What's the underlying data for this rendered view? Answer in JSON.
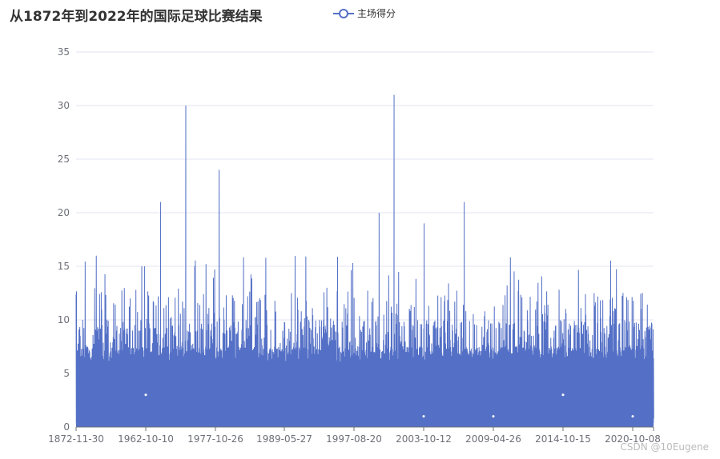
{
  "chart_data": {
    "type": "line",
    "title": "从1872年到2022年的国际足球比赛结果",
    "legend": [
      "主场得分"
    ],
    "series": [
      {
        "name": "主场得分",
        "color": "#5470c6"
      }
    ],
    "xlabel": "",
    "ylabel": "",
    "ylim": [
      0,
      35
    ],
    "yticks": [
      "0",
      "5",
      "10",
      "15",
      "20",
      "25",
      "30",
      "35"
    ],
    "xtick_labels": [
      "1872-11-30",
      "1962-10-10",
      "1977-10-26",
      "1989-05-27",
      "1997-08-20",
      "2003-10-12",
      "2009-04-26",
      "2014-10-15",
      "2020-10-08"
    ],
    "peaks": [
      {
        "x": "1966-01",
        "y": 21
      },
      {
        "x": "1971-06",
        "y": 30
      },
      {
        "x": "1978-06",
        "y": 24
      },
      {
        "x": "2001-03",
        "y": 31
      },
      {
        "x": "1999-11",
        "y": 20
      },
      {
        "x": "2003-11",
        "y": 19
      },
      {
        "x": "2007-01",
        "y": 21
      },
      {
        "x": "1961-05",
        "y": 15
      },
      {
        "x": "1973-05",
        "y": 15
      },
      {
        "x": "1957-09",
        "y": 15
      }
    ],
    "grid": true,
    "legend_position": "top-center"
  },
  "watermark": "CSDN @10Eugene"
}
